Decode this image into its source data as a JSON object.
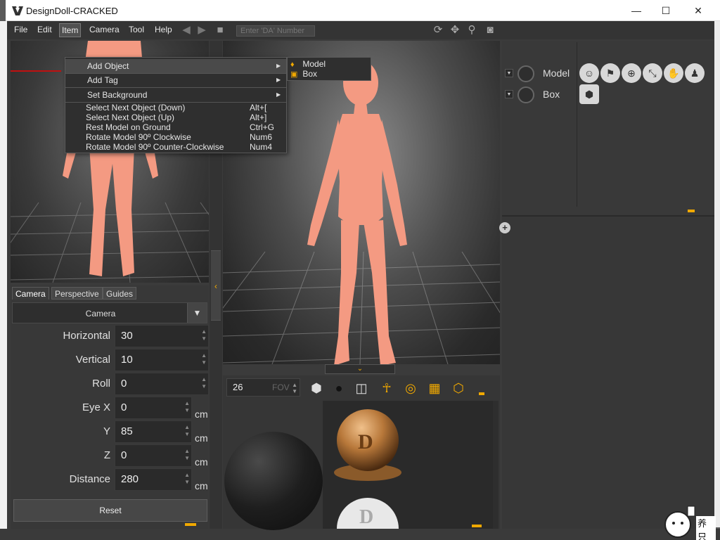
{
  "window": {
    "title": "DesignDoll-CRACKED",
    "minimize": "—",
    "maximize": "☐",
    "close": "✕"
  },
  "menubar": {
    "items": [
      "File",
      "Edit",
      "Item",
      "Camera",
      "Tool",
      "Help"
    ],
    "active": "Item",
    "da_placeholder": "Enter 'DA' Number"
  },
  "item_menu": {
    "add_object": "Add Object",
    "add_tag": "Add Tag",
    "set_background": "Set Background",
    "commands": [
      {
        "label": "Select Next Object (Down)",
        "shortcut": "Alt+["
      },
      {
        "label": "Select Next Object (Up)",
        "shortcut": "Alt+]"
      },
      {
        "label": "Rest Model on Ground",
        "shortcut": "Ctrl+G"
      },
      {
        "label": "Rotate Model 90º Clockwise",
        "shortcut": "Num6"
      },
      {
        "label": "Rotate Model 90º Counter-Clockwise",
        "shortcut": "Num4"
      }
    ]
  },
  "add_object_submenu": {
    "items": [
      "Model",
      "Box"
    ]
  },
  "camera_panel": {
    "tabs": [
      "Camera",
      "Perspective",
      "Guides"
    ],
    "selected_camera": "Camera",
    "props": [
      {
        "label": "Horizontal",
        "value": "30",
        "unit": ""
      },
      {
        "label": "Vertical",
        "value": "10",
        "unit": ""
      },
      {
        "label": "Roll",
        "value": "0",
        "unit": ""
      },
      {
        "label": "Eye X",
        "value": "0",
        "unit": "cm"
      },
      {
        "label": "Y",
        "value": "85",
        "unit": "cm"
      },
      {
        "label": "Z",
        "value": "0",
        "unit": "cm"
      },
      {
        "label": "Distance",
        "value": "280",
        "unit": "cm"
      }
    ],
    "reset_label": "Reset"
  },
  "material_panel": {
    "fov_value": "26",
    "fov_label": "FOV"
  },
  "scene_tree": {
    "items": [
      {
        "name": "Model"
      },
      {
        "name": "Box"
      }
    ]
  },
  "mascot_text": "养只大",
  "colors": {
    "accent": "#f0a800",
    "skin": "#f49a82",
    "panel": "#383838"
  }
}
